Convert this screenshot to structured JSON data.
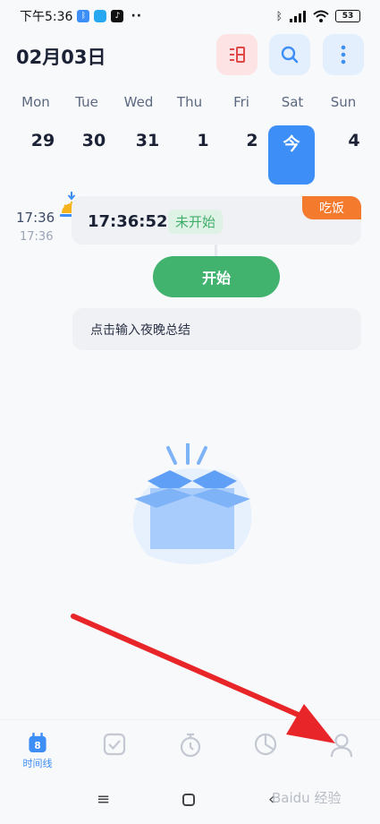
{
  "status_bar": {
    "time": "下午5:36",
    "dots": "··",
    "battery": "53"
  },
  "header": {
    "date": "02月03日",
    "icons": [
      "leaderboard-icon",
      "search-icon",
      "more-vertical-icon"
    ]
  },
  "week": {
    "labels": [
      "Mon",
      "Tue",
      "Wed",
      "Thu",
      "Fri",
      "Sat",
      "Sun"
    ],
    "days": [
      "29",
      "30",
      "31",
      "1",
      "2",
      "今",
      "4"
    ]
  },
  "timeline": {
    "time_main": "17:36",
    "time_sub": "17:36",
    "card_time": "17:36:52",
    "status_badge": "未开始",
    "tag": "吃饭",
    "start_button": "开始",
    "summary_placeholder": "点击输入夜晚总结"
  },
  "bottom_nav": {
    "timeline_label": "时间线",
    "calendar_number": "8"
  },
  "watermark": "Baidu 经验",
  "colors": {
    "accent": "#3d8ef7",
    "green": "#42b36f",
    "orange": "#f47a2e",
    "red_arrow": "#e8262a"
  }
}
